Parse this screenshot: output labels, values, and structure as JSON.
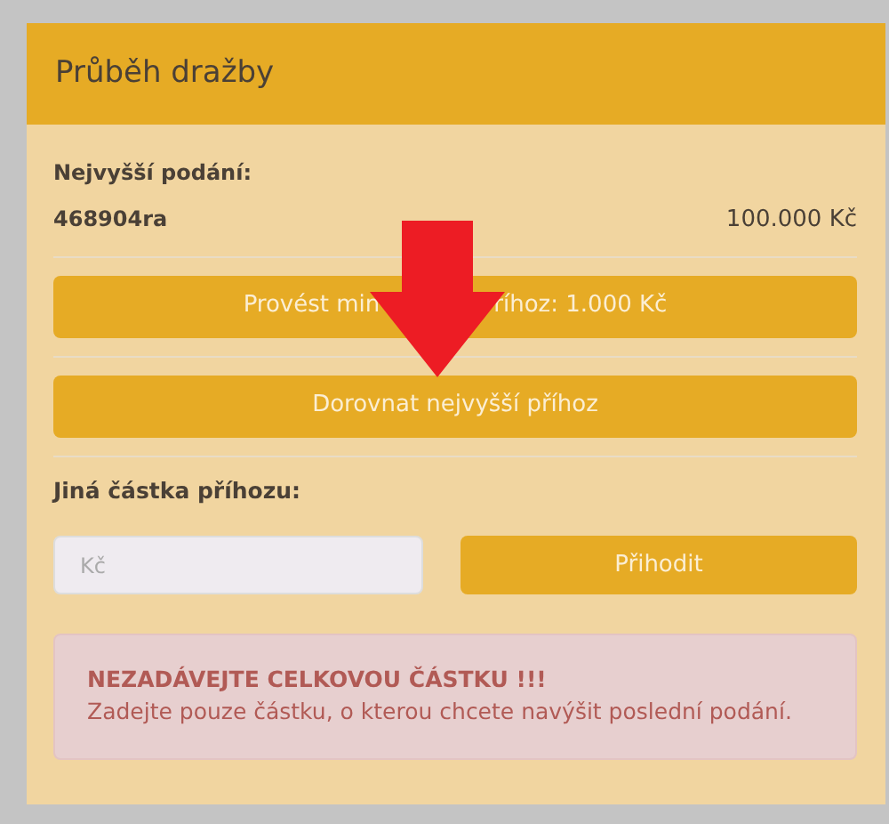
{
  "panel": {
    "title": "Průběh dražby"
  },
  "highest_bid": {
    "label": "Nejvyšší podání:",
    "bidder": "468904ra",
    "amount": "100.000 Kč"
  },
  "actions": [
    {
      "text_parts": [
        "Provést min",
        "říhoz: 1.000 Kč"
      ]
    },
    {
      "text_parts": [
        "Dorovnat nejvyšší příhoz"
      ]
    }
  ],
  "custom_bid": {
    "label": "Jiná částka příhozu:",
    "placeholder": "Kč",
    "button": "Přihodit"
  },
  "warning": {
    "title": "NEZADÁVEJTE CELKOVOU ČÁSTKU !!!",
    "text": "Zadejte pouze částku, o kterou chcete navýšit poslední podání."
  }
}
